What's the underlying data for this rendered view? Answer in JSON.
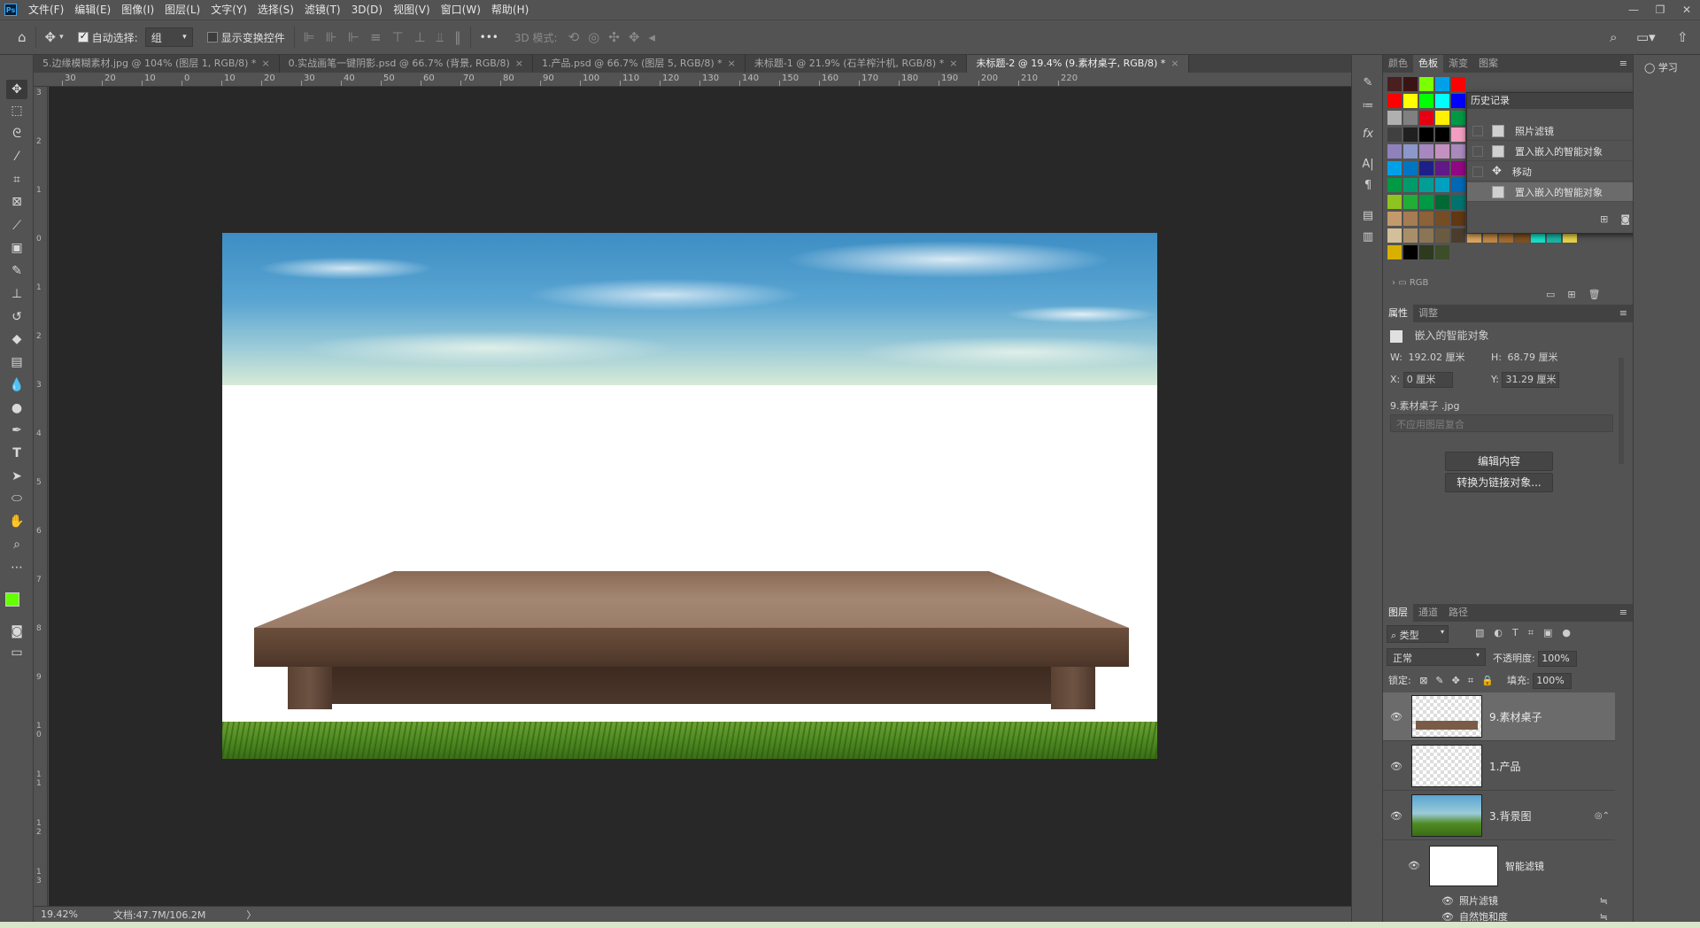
{
  "app": {
    "logo": "Ps"
  },
  "menu": [
    "文件(F)",
    "编辑(E)",
    "图像(I)",
    "图层(L)",
    "文字(Y)",
    "选择(S)",
    "滤镜(T)",
    "3D(D)",
    "视图(V)",
    "窗口(W)",
    "帮助(H)"
  ],
  "window_controls": {
    "minimize": "—",
    "restore": "❐",
    "close": "✕"
  },
  "options": {
    "auto_select_label": "自动选择:",
    "auto_select_value": "组",
    "show_transform_label": "显示变换控件",
    "more": "•••",
    "mode_3d_label": "3D 模式:"
  },
  "tabs": [
    {
      "label": "5.边缘模糊素材.jpg @ 104% (图层 1, RGB/8) *",
      "close": "×"
    },
    {
      "label": "0.实战画笔一键阴影.psd @ 66.7% (背景, RGB/8)",
      "close": "×"
    },
    {
      "label": "1.产品.psd @ 66.7% (图层 5, RGB/8) *",
      "close": "×"
    },
    {
      "label": "未标题-1 @ 21.9% (石羊榨汁机, RGB/8) *",
      "close": "×"
    },
    {
      "label": "未标题-2 @ 19.4% (9.素材桌子, RGB/8) *",
      "close": "×"
    }
  ],
  "ruler_top": [
    "30",
    "20",
    "10",
    "0",
    "10",
    "20",
    "30",
    "40",
    "50",
    "60",
    "70",
    "80",
    "90",
    "100",
    "110",
    "120",
    "130",
    "140",
    "150",
    "160",
    "170",
    "180",
    "190",
    "200",
    "210",
    "220"
  ],
  "ruler_left": [
    "3",
    "2",
    "1",
    "0",
    "1",
    "2",
    "3",
    "4",
    "5",
    "6",
    "7",
    "8",
    "9",
    "10",
    "11",
    "12",
    "13"
  ],
  "status": {
    "zoom": "19.42%",
    "doc": "文档:47.7M/106.2M",
    "arrow": "〉"
  },
  "swatch_panel": {
    "tabs": [
      "颜色",
      "色板",
      "渐变",
      "图案"
    ],
    "group_label": "RGB"
  },
  "swatch_colors": [
    [
      "#4a1f1f",
      "#3a1414",
      "#7cff00",
      "#00a0e9",
      "#ff0000"
    ],
    [
      "#ff0000",
      "#ffff00",
      "#00ff00",
      "#00ffff",
      "#0000ff",
      "#ff00ff"
    ],
    [
      "#b0b0b0",
      "#808080",
      "#e60012",
      "#fff100",
      "#009944",
      "#ea68a2"
    ],
    [
      "#404040",
      "#202020",
      "#000000",
      "#000000",
      "#f19ec2",
      "#ec6941"
    ],
    [
      "#8f82bc",
      "#8c97cb",
      "#a687bf",
      "#c490bf",
      "#aa89bd",
      "#e5004f"
    ],
    [
      "#00a0e9",
      "#0075c2",
      "#1d2088",
      "#601986",
      "#920783",
      "#e4007f"
    ],
    [
      "#009944",
      "#009b6b",
      "#009e96",
      "#00a0c1",
      "#0068b7",
      "#00479d"
    ],
    [
      "#8fc31f",
      "#22ac38",
      "#009944",
      "#006934",
      "#00736d",
      "#005e84"
    ],
    [
      "#c49a6c",
      "#a67c52",
      "#8c6239",
      "#754c24",
      "#603813",
      "#13b5b1"
    ],
    [
      "#d2c09a",
      "#a88f6a",
      "#8a7555",
      "#6b5a42",
      "#4a3d2e",
      "#d9a55f",
      "#c18744",
      "#a26b2e",
      "#7e501d",
      "#15e0c6",
      "#19b5a5",
      "#e6d24a"
    ],
    [
      "#d9b000",
      "#000000",
      "#2d3a1e",
      "#3c4d27"
    ]
  ],
  "history": {
    "title": "历史记录",
    "items": [
      "照片滤镜",
      "置入嵌入的智能对象",
      "移动",
      "置入嵌入的智能对象"
    ]
  },
  "properties": {
    "tabs": [
      "属性",
      "调整"
    ],
    "type_label": "嵌入的智能对象",
    "w_label": "W:",
    "w_value": "192.02 厘米",
    "h_label": "H:",
    "h_value": "68.79 厘米",
    "x_label": "X:",
    "x_value": "0 厘米",
    "y_label": "Y:",
    "y_value": "31.29 厘米",
    "file_name": "9.素材桌子 .jpg",
    "comp_placeholder": "不应用图层复合",
    "edit_button": "编辑内容",
    "convert_button": "转换为链接对象..."
  },
  "layers_panel": {
    "tabs": [
      "图层",
      "通道",
      "路径"
    ],
    "filter_label": "类型",
    "blend_mode": "正常",
    "opacity_label": "不透明度:",
    "opacity_value": "100%",
    "lock_label": "锁定:",
    "fill_label": "填充:",
    "fill_value": "100%",
    "layers": [
      "9.素材桌子",
      "1.产品",
      "3.背景图"
    ],
    "smart_filter_label": "智能滤镜",
    "filters": [
      "照片滤镜",
      "自然饱和度"
    ]
  },
  "far_right": {
    "learn_label": "学习"
  }
}
